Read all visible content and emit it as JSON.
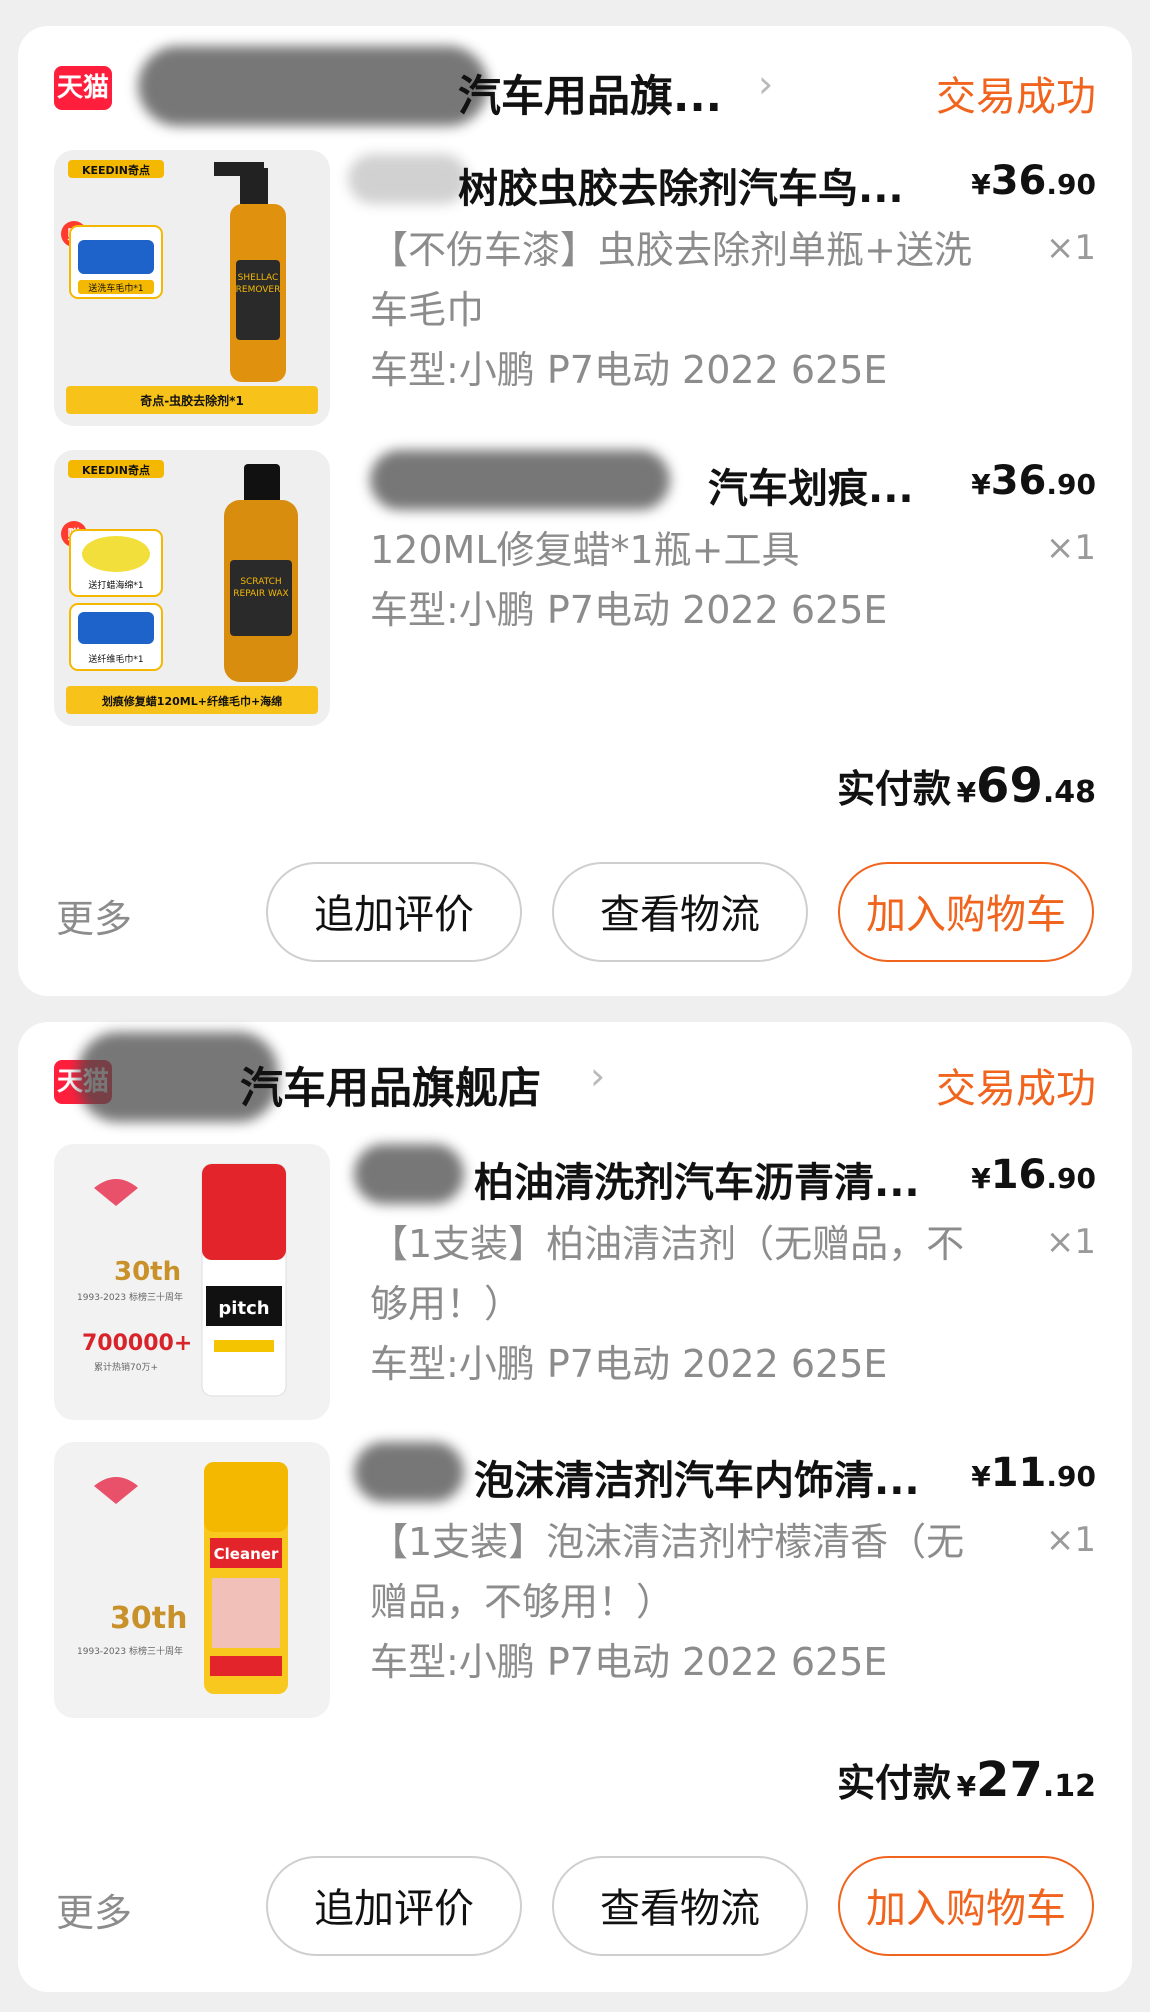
{
  "orders": [
    {
      "shop": {
        "name": "汽车用品旗...",
        "platform_logo": "天猫",
        "status": "交易成功"
      },
      "items": [
        {
          "title": "树胶虫胶去除剂汽车鸟...",
          "price": {
            "currency": "¥",
            "int": "36",
            "dec": ".90"
          },
          "sku": "【不伤车漆】虫胶去除剂单瓶+送洗车毛巾",
          "vehicle": "车型:小鹏 P7电动 2022 625E",
          "qty": "×1",
          "thumb": {
            "brand": "KEEDIN奇点",
            "gift_mark": "赠",
            "gift_label": "送洗车毛巾*1",
            "band": "奇点-虫胶去除剂*1",
            "bottle_label": "SHELLAC REMOVER"
          }
        },
        {
          "title": "汽车划痕...",
          "price": {
            "currency": "¥",
            "int": "36",
            "dec": ".90"
          },
          "sku": "120ML修复蜡*1瓶+工具",
          "vehicle": "车型:小鹏 P7电动 2022 625E",
          "qty": "×1",
          "thumb": {
            "brand": "KEEDIN奇点",
            "gift_mark": "赠",
            "gift_label": "送打蜡海绵*1",
            "gift_label_2": "送纤维毛巾*1",
            "band": "划痕修复蜡120ML+纤维毛巾+海绵",
            "bottle_label": "SCRATCH REPAIR WAX"
          }
        }
      ],
      "paid": {
        "label": "实付款",
        "currency": "¥",
        "int": "69",
        "dec": ".48"
      },
      "actions": {
        "more": "更多",
        "review": "追加评价",
        "logistics": "查看物流",
        "add_cart": "加入购物车"
      }
    },
    {
      "shop": {
        "name": "汽车用品旗舰店",
        "platform_logo": "天猫",
        "status": "交易成功"
      },
      "items": [
        {
          "title": "柏油清洗剂汽车沥青清...",
          "price": {
            "currency": "¥",
            "int": "16",
            "dec": ".90"
          },
          "sku": "【1支装】柏油清洁剂（无赠品，不够用！）",
          "vehicle": "车型:小鹏 P7电动 2022 625E",
          "qty": "×1",
          "thumb": {
            "anniv": "30th",
            "anniv_sub": "1993-2023 标榜三十周年",
            "count": "700000+",
            "count_sub": "累计热销70万+",
            "can_label": "pitch"
          }
        },
        {
          "title": "泡沫清洁剂汽车内饰清...",
          "price": {
            "currency": "¥",
            "int": "11",
            "dec": ".90"
          },
          "sku": "【1支装】泡沫清洁剂柠檬清香（无赠品，不够用！）",
          "vehicle": "车型:小鹏 P7电动 2022 625E",
          "qty": "×1",
          "thumb": {
            "anniv": "30th",
            "anniv_sub": "1993-2023 标榜三十周年",
            "can_label": "Cleaner"
          }
        }
      ],
      "paid": {
        "label": "实付款",
        "currency": "¥",
        "int": "27",
        "dec": ".12"
      },
      "actions": {
        "more": "更多",
        "review": "追加评价",
        "logistics": "查看物流",
        "add_cart": "加入购物车"
      }
    }
  ]
}
